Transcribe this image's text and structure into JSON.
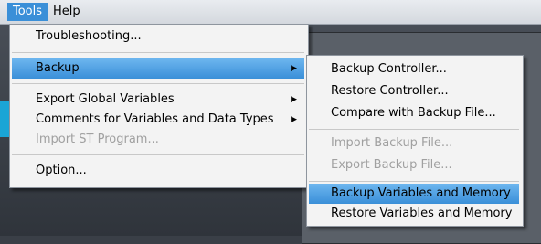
{
  "menubar": {
    "tools": "Tools",
    "help": "Help"
  },
  "tools_menu": {
    "troubleshooting": "Troubleshooting...",
    "backup": "Backup",
    "export_global_variables": "Export Global Variables",
    "comments": "Comments for Variables and Data Types",
    "import_st_program": "Import ST Program...",
    "option": "Option..."
  },
  "backup_submenu": {
    "backup_controller": "Backup Controller...",
    "restore_controller": "Restore Controller...",
    "compare_with_backup_file": "Compare with Backup File...",
    "import_backup_file": "Import Backup File...",
    "export_backup_file": "Export Backup File...",
    "backup_variables_and_memory": "Backup Variables and Memory",
    "restore_variables_and_memory": "Restore Variables and Memory"
  },
  "colors": {
    "highlight": "#3a8fd8",
    "menu_background": "#f3f3f3",
    "disabled_text": "#a0a0a0"
  }
}
